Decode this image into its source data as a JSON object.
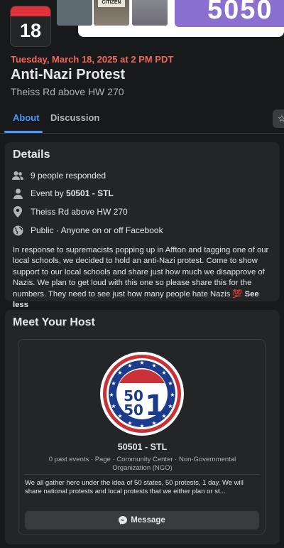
{
  "cover": {
    "thumb_sign": "CITIZEN",
    "banner_text": "5050"
  },
  "calendar": {
    "day": "18"
  },
  "event": {
    "date_line": "Tuesday, March 18, 2025 at 2 PM PDT",
    "title": "Anti-Nazi Protest",
    "location": "Theiss Rd above HW 270"
  },
  "tabs": {
    "about": "About",
    "discussion": "Discussion"
  },
  "details": {
    "title": "Details",
    "responded": "9 people responded",
    "event_by_prefix": "Event by ",
    "event_by_name": "50501 - STL",
    "location": "Theiss Rd above HW 270",
    "privacy": "Public · Anyone on or off Facebook",
    "description": "In response to supremacists popping up in Affton and tagging one of our local schools, we decided to hold an anti-Nazi protest. Come to show support to our local schools and share just how much we disapprove of Nazis. We plan to get loud with this one so please share this for the numbers. They need to see just how many people hate Nazis 💯 ",
    "see_less": "See less"
  },
  "host": {
    "title": "Meet Your Host",
    "logo_top": "50",
    "logo_mid": "50",
    "logo_one": "1",
    "name": "50501 - STL",
    "meta": "0 past events · Page · Community Center · Non-Governmental Organization (NGO)",
    "description": "We all gather here under the idea of 50 states, 50 protests, 1 day. We will share national protests and local protests that we either plan or st...",
    "message_label": "Message"
  },
  "colors": {
    "accent": "#4599ff",
    "date": "#f0685c",
    "calendar_red": "#e0323b",
    "banner_purple": "#8a6ed0",
    "logo_blue": "#1b3c8c",
    "logo_red": "#c83236"
  }
}
